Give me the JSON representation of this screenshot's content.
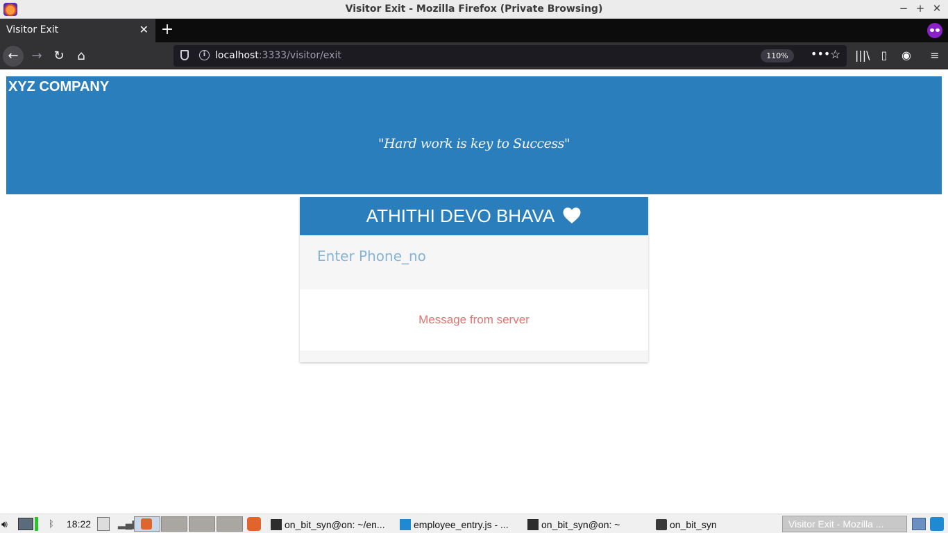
{
  "window": {
    "title": "Visitor Exit - Mozilla Firefox (Private Browsing)",
    "minimize": "−",
    "maximize": "+",
    "close": "✕"
  },
  "tabs": [
    {
      "label": "Visitor Exit",
      "close": "✕"
    }
  ],
  "newtab": "+",
  "nav": {
    "back": "←",
    "forward": "→",
    "reload": "↻",
    "home": "⌂",
    "url_host": "localhost",
    "url_rest": ":3333/visitor/exit",
    "info": "i",
    "zoom": "110%",
    "more": "•••",
    "star": "☆",
    "library": "|||\\",
    "sidebar": "▯",
    "account": "◉",
    "menu": "≡"
  },
  "page": {
    "company": "XYZ COMPANY",
    "quote": "\"Hard work is key to Success\"",
    "card_title": "ATHITHI DEVO BHAVA",
    "phone_placeholder": "Enter Phone_no",
    "phone_value": "",
    "message": "Message from server"
  },
  "taskbar": {
    "clock": "18:22",
    "tasks": [
      {
        "label": "on_bit_syn@on: ~/en..."
      },
      {
        "label": "employee_entry.js - ..."
      },
      {
        "label": "on_bit_syn@on: ~"
      },
      {
        "label": "on_bit_syn"
      }
    ],
    "active_task": "Visitor Exit - Mozilla ..."
  },
  "colors": {
    "brand_blue": "#2a7ebb",
    "message_red": "#e07270",
    "placeholder_blue": "#86b4d8"
  }
}
